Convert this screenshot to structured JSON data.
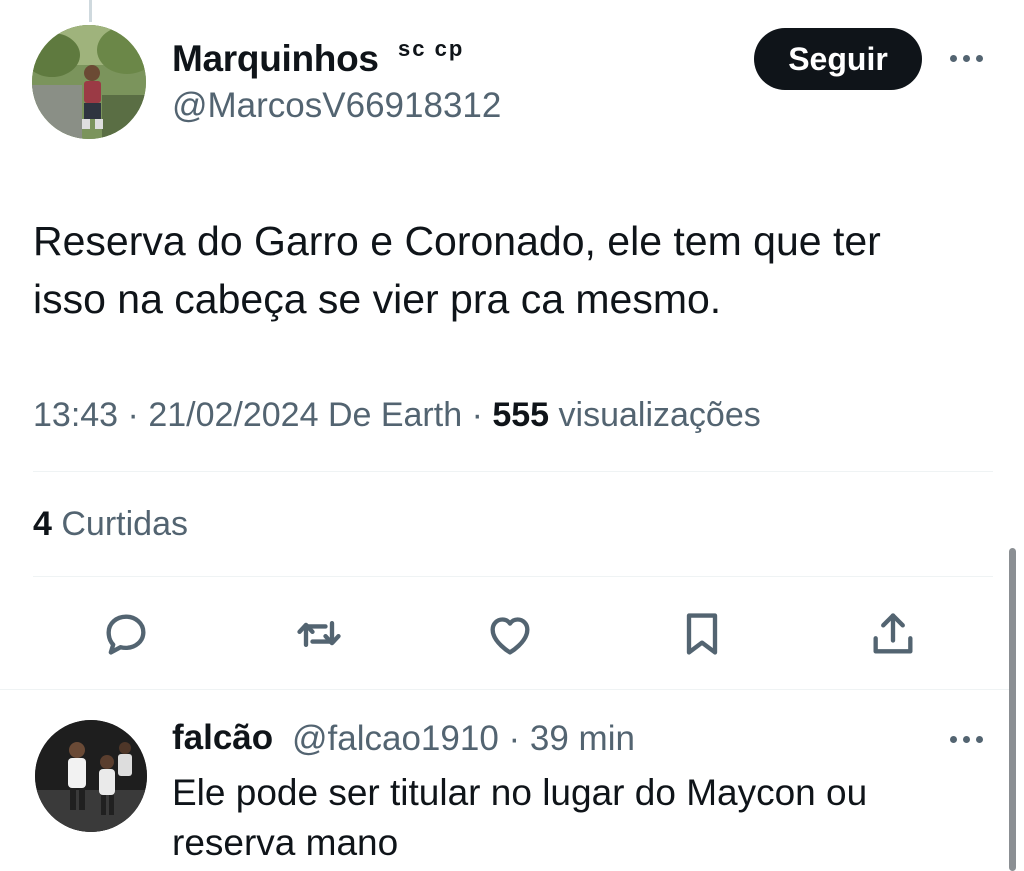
{
  "tweet": {
    "author": {
      "name": "Marquinhos",
      "badge": "sc cp",
      "handle": "@MarcosV66918312"
    },
    "follow_label": "Seguir",
    "text_line1": "Reserva do Garro e Coronado, ele tem que ter",
    "text_line2": "isso na cabeça se vier pra ca mesmo.",
    "time": "13:43",
    "date": "21/02/2024",
    "source": "De Earth",
    "views_count": "555",
    "views_label": "visualizações",
    "likes_count": "4",
    "likes_label": "Curtidas"
  },
  "actions": [
    {
      "icon": "reply-icon"
    },
    {
      "icon": "retweet-icon"
    },
    {
      "icon": "like-icon"
    },
    {
      "icon": "bookmark-icon"
    },
    {
      "icon": "share-icon"
    }
  ],
  "reply": {
    "name": "falcão",
    "handle": "@falcao1910",
    "time": "39 min",
    "text_line1": "Ele pode ser titular no lugar do Maycon ou",
    "text_line2": "reserva mano"
  },
  "colors": {
    "primary_text": "#0f1419",
    "secondary_text": "#536471",
    "divider": "#eff3f4",
    "follow_button": "#0f1419"
  }
}
